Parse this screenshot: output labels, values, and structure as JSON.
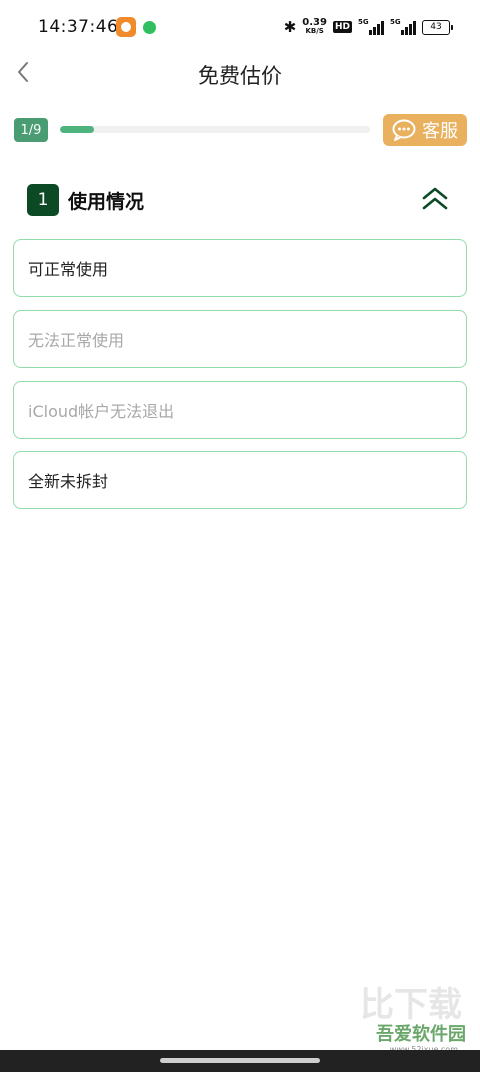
{
  "status_bar": {
    "time": "14:37:46",
    "net_speed_value": "0.39",
    "net_speed_unit": "KB/S",
    "hd_label": "HD",
    "signal1_label": "5G",
    "signal2_label": "5G",
    "battery_level": "43"
  },
  "nav": {
    "title": "免费估价"
  },
  "progress": {
    "step_label": "1/9",
    "fraction": 0.111
  },
  "service": {
    "label": "客服"
  },
  "section": {
    "number": "1",
    "title": "使用情况"
  },
  "options": [
    {
      "label": "可正常使用",
      "enabled": true
    },
    {
      "label": "无法正常使用",
      "enabled": false
    },
    {
      "label": "iCloud帐户无法退出",
      "enabled": false
    },
    {
      "label": "全新未拆封",
      "enabled": true
    }
  ],
  "watermark": {
    "big": "比下载",
    "text": "吾爱软件园",
    "url": "www.52ixue.com"
  },
  "colors": {
    "accent_green": "#4fb37e",
    "section_green": "#0c4a25",
    "service_orange": "#e9b05e",
    "option_border": "#8fdcaa"
  }
}
